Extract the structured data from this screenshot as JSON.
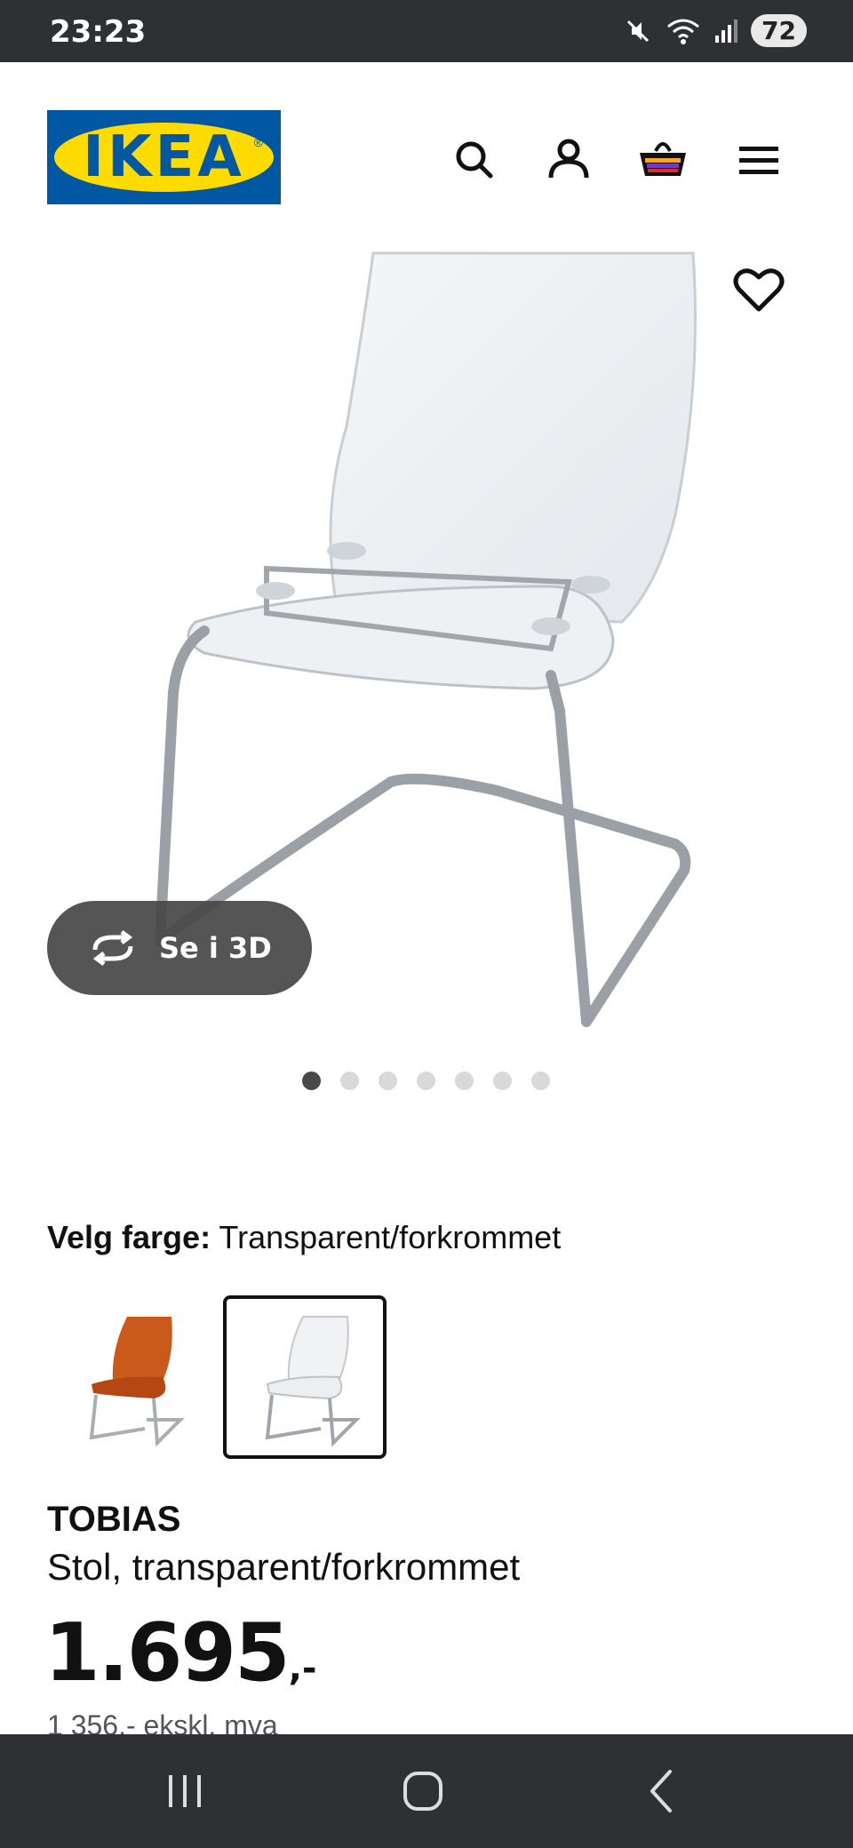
{
  "status_bar": {
    "time": "23:23",
    "battery": "72",
    "icons": [
      "mute-icon",
      "wifi-icon",
      "signal-icon"
    ]
  },
  "header": {
    "logo_text": "IKEA",
    "logo_reg": "®",
    "icons": [
      "search-icon",
      "account-icon",
      "cart-icon",
      "menu-icon"
    ],
    "colors": {
      "brand_blue": "#0058a3",
      "brand_yellow": "#ffdb00"
    }
  },
  "gallery": {
    "view_3d_label": "Se i 3D",
    "image_count": 7,
    "active_index": 0
  },
  "color_picker": {
    "label": "Velg farge:",
    "selected_value": "Transparent/forkrommet",
    "options": [
      "orange-chair",
      "transparent-chair"
    ],
    "selected_index": 1
  },
  "product": {
    "name": "TOBIAS",
    "description": "Stol, transparent/forkrommet",
    "price": "1.695",
    "price_suffix": ",-",
    "price_ex_vat": "1 356,- ekskl. mva"
  },
  "nav_bar": {
    "icons": [
      "recents-icon",
      "home-icon",
      "back-icon"
    ]
  }
}
